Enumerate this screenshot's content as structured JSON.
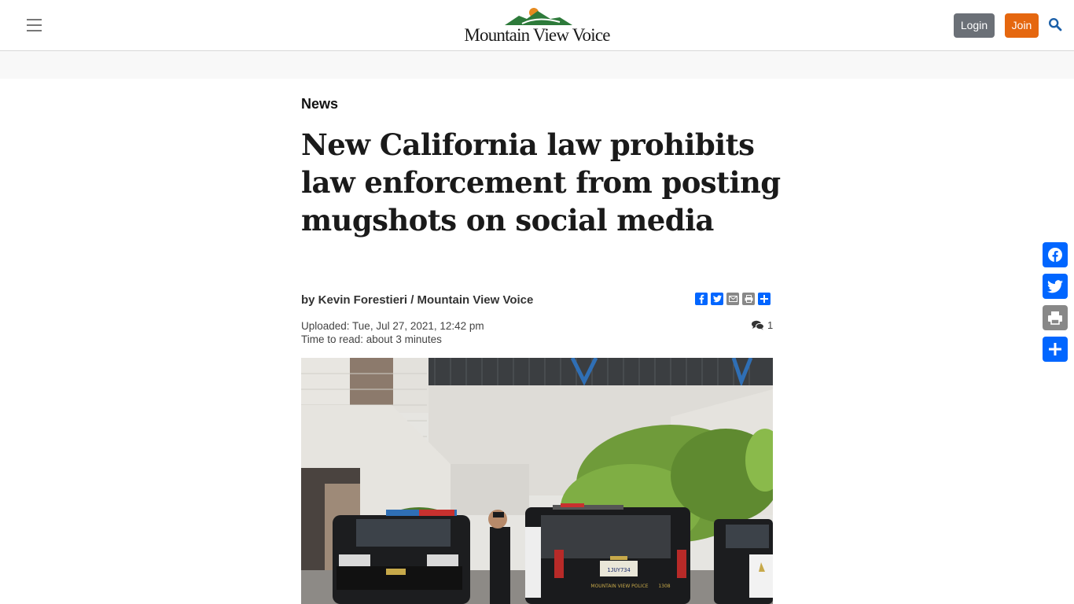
{
  "header": {
    "logo_text": "Mountain View Voice",
    "login_label": "Login",
    "join_label": "Join"
  },
  "article": {
    "section": "News",
    "headline": "New California law prohibits law enforcement from posting mugshots on social media",
    "byline": "by Kevin Forestieri / Mountain View Voice",
    "uploaded": "Uploaded: Tue, Jul 27, 2021, 12:42 pm",
    "time_to_read": "Time to read: about 3 minutes",
    "comment_count": "1",
    "photo_text": {
      "license_plate": "1JUY734",
      "tailgate": "MOUNTAIN VIEW POLICE",
      "unit_number": "1308"
    }
  },
  "share_inline": [
    "facebook-icon",
    "twitter-icon",
    "email-icon",
    "print-icon",
    "share-icon"
  ],
  "share_float": [
    "facebook-icon",
    "twitter-icon",
    "print-icon",
    "share-icon"
  ],
  "colors": {
    "share_blue": "#0166ff",
    "print_gray": "#888888",
    "join_orange": "#e5670f",
    "login_gray": "#6b7077",
    "search_blue": "#1a5fa8"
  }
}
